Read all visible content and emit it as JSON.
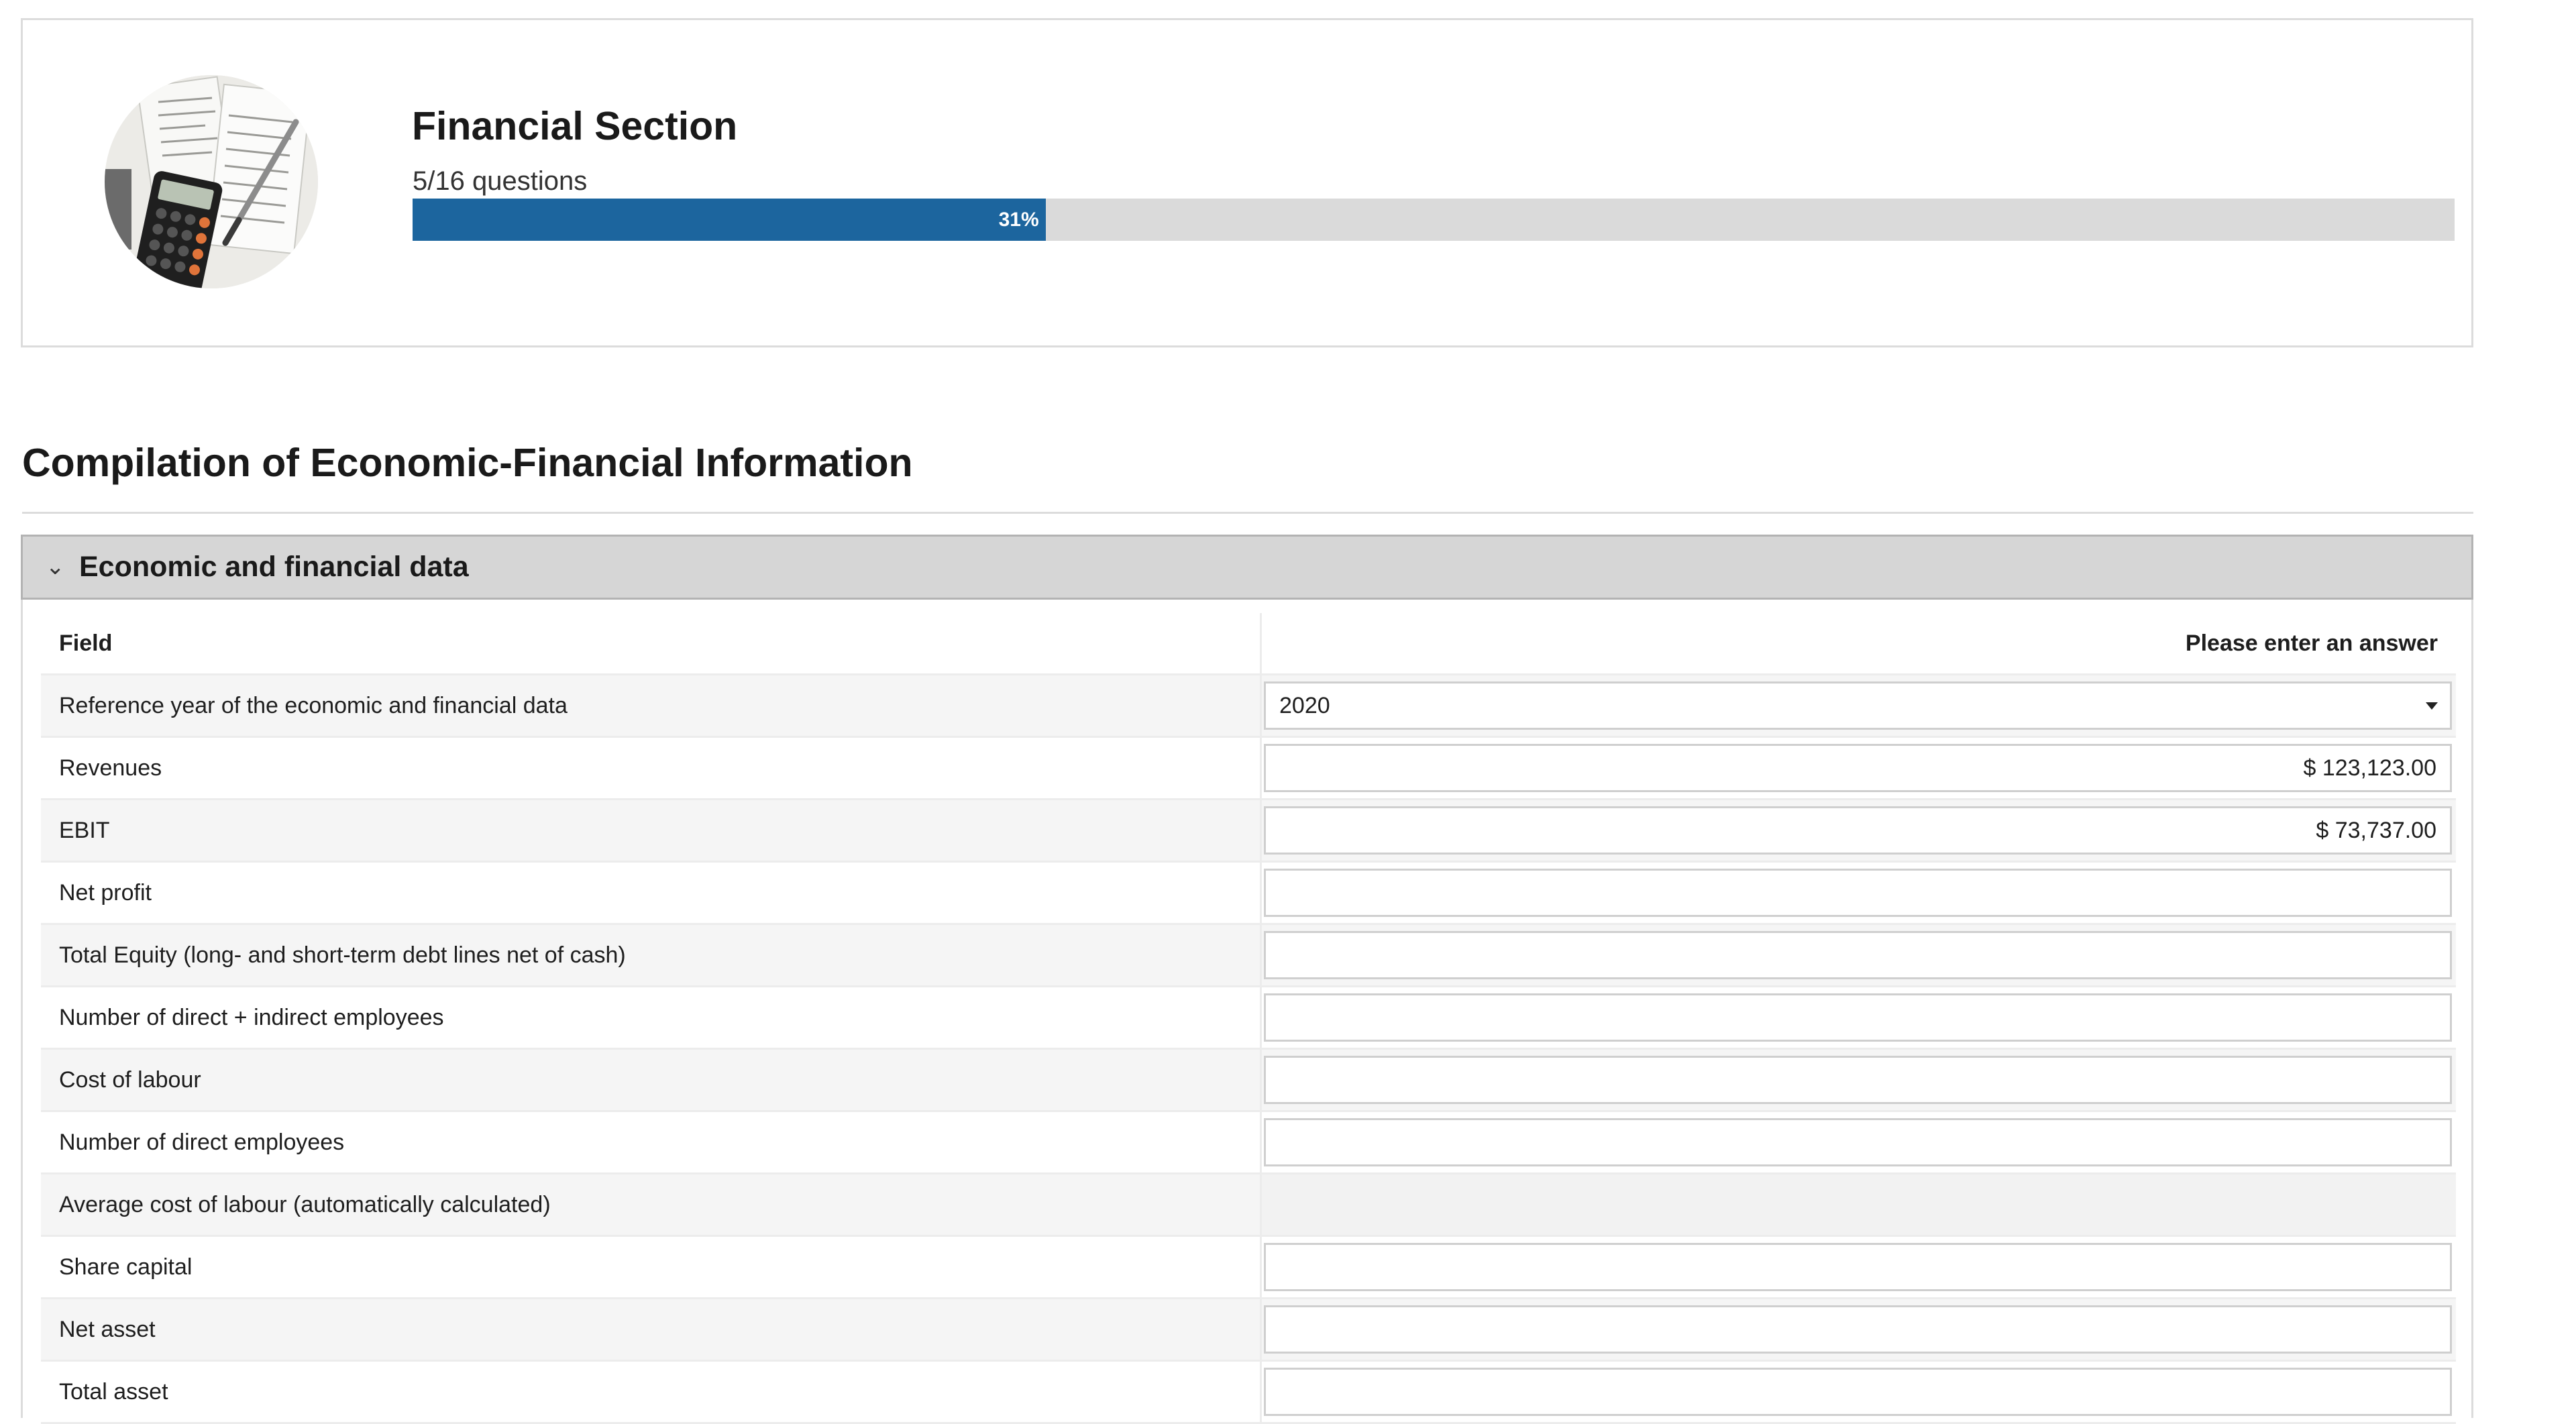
{
  "header": {
    "title": "Financial Section",
    "questions": "5/16 questions",
    "progress_label": "31%",
    "progress_fraction": 0.31,
    "accent": "#1c659e",
    "avatar_icon": "calculator-documents-image"
  },
  "page": {
    "heading": "Compilation of Economic-Financial Information"
  },
  "accordion": {
    "chevron": "⌄",
    "chevron_icon": "chevron-down-icon",
    "title": "Economic and financial data"
  },
  "table": {
    "col_field": "Field",
    "col_answer": "Please enter an answer",
    "rows": [
      {
        "label": "Reference year of the economic and financial data",
        "value": "2020",
        "type": "select"
      },
      {
        "label": "Revenues",
        "value": "$ 123,123.00",
        "type": "input"
      },
      {
        "label": "EBIT",
        "value": "$ 73,737.00",
        "type": "input"
      },
      {
        "label": "Net profit",
        "value": "",
        "type": "input"
      },
      {
        "label": "Total Equity (long- and short-term debt lines net of cash)",
        "value": "",
        "type": "input"
      },
      {
        "label": "Number of direct + indirect employees",
        "value": "",
        "type": "input"
      },
      {
        "label": "Cost of labour",
        "value": "",
        "type": "input"
      },
      {
        "label": "Number of direct employees",
        "value": "",
        "type": "input"
      },
      {
        "label": "Average cost of labour (automatically calculated)",
        "value": "",
        "type": "readonly"
      },
      {
        "label": "Share capital",
        "value": "",
        "type": "input"
      },
      {
        "label": "Net asset",
        "value": "",
        "type": "input"
      },
      {
        "label": "Total asset",
        "value": "",
        "type": "input"
      }
    ]
  }
}
